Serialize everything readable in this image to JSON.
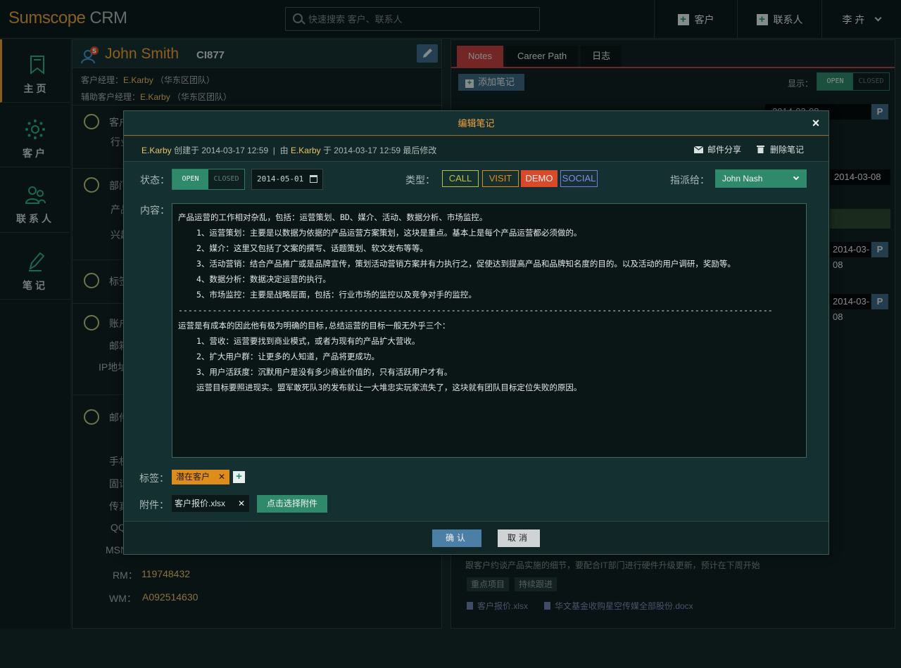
{
  "app": {
    "brand": "Sumscope",
    "product": "CRM"
  },
  "search": {
    "placeholder": "快速搜索 客户、联系人"
  },
  "header": {
    "add_customer": "客户",
    "add_contact": "联系人",
    "user": "李 卉"
  },
  "sidebar": {
    "items": [
      {
        "label": "主页",
        "icon": "bookmark-icon"
      },
      {
        "label": "客户",
        "icon": "gear-icon"
      },
      {
        "label": "联系人",
        "icon": "people-icon"
      },
      {
        "label": "笔记",
        "icon": "pen-icon"
      }
    ]
  },
  "profile": {
    "name": "John Smith",
    "code": "CI877",
    "account_manager_label": "客户经理：",
    "account_manager": "E.Karby",
    "account_manager_team": "（华东区团队）",
    "assistant_manager_label": "辅助客户经理：",
    "assistant_manager": "E.Karby",
    "assistant_manager_team": "（华东区团队）",
    "sections": {
      "customer": "客户",
      "industry": "行业",
      "department": "部门",
      "product": "产品",
      "interest": "兴趣",
      "tags": "标签",
      "account": "账户",
      "email": "邮箱",
      "ip": "IP地址",
      "mail": "邮件",
      "phone": "手机",
      "landline": "固话",
      "fax": "传真",
      "qq": "QQ",
      "msn": "MSN"
    },
    "rm_label": "RM：",
    "rm": "119748432",
    "wm_label": "WM：",
    "wm": "A092514630"
  },
  "notes_panel": {
    "tabs": [
      "Notes",
      "Career Path",
      "日志"
    ],
    "add_note": "添加笔记",
    "display_label": "显示：",
    "toggle_open": "OPEN",
    "toggle_closed": "CLOSED",
    "dates": [
      "2014-03-08",
      "2014-03-08",
      "2014-03-08",
      "2014-03-08"
    ],
    "badge": "P",
    "bg_desc": "跟客户约谈产品实施的细节，要配合IT部门进行硬件升级更新，预计在下周开始",
    "bg_tags": [
      "重点项目",
      "持续跟进"
    ],
    "bg_files": [
      "客户报价.xlsx",
      "华文基金收购星空传媒全部股份.docx"
    ]
  },
  "modal": {
    "title": "编辑笔记",
    "creator": "E.Karby",
    "created_text": "创建于 2014-03-17 12:59",
    "by_text": "由",
    "modifier": "E.Karby",
    "modified_text": "于 2014-03-17 12:59 最后修改",
    "share_mail": "邮件分享",
    "delete_note": "删除笔记",
    "status_label": "状态：",
    "status_open": "OPEN",
    "status_closed": "CLOSED",
    "date": "2014-05-01",
    "type_label": "类型：",
    "types": [
      {
        "label": "CALL",
        "color": "#b8c04a"
      },
      {
        "label": "VISIT",
        "color": "#e08c1a"
      },
      {
        "label": "DEMO",
        "color": "#d84a2a"
      },
      {
        "label": "SOCIAL",
        "color": "#7a7ad8"
      }
    ],
    "assign_label": "指派给：",
    "assignee": "John Nash",
    "content_label": "内容：",
    "content_lines": [
      "产品运营的工作相对杂乱，包括：运营策划、BD、媒介、活动、数据分析、市场监控。",
      "1、运营策划：主要是以数据为依据的产品运营方案策划，这块是重点。基本上是每个产品运营都必须做的。",
      "2、媒介：这里又包括了文案的撰写、话题策划、软文发布等等。",
      "3、活动营销：结合产品推广或是品牌宣传，策划活动营销方案并有力执行之，促使达到提高产品和品牌知名度的目的。以及活动的用户调研，奖励等。",
      "4、数据分析：数据决定运营的执行。",
      "5、市场监控：主要是战略层面，包括：行业市场的监控以及竞争对手的监控。",
      "--------------------------------------------------------------------------------------------------------------------------",
      "运营是有成本的因此他有极为明确的目标,总结运营的目标一般无外乎三个：",
      "1、营收：运营要找到商业模式，或者为现有的产品扩大营收。",
      "2、扩大用户群：让更多的人知道，产品将更成功。",
      "3、用户活跃度：沉默用户是没有多少商业价值的，只有活跃用户才有。",
      "运营目标要照进现实。盟军敢死队3的发布就让一大堆忠实玩家流失了，这块就有团队目标定位失败的原因。"
    ],
    "tags_label": "标签：",
    "tag": "潜在客户",
    "attach_label": "附件：",
    "attachment": "客户报价.xlsx",
    "choose_attachment": "点击选择附件",
    "confirm": "确认",
    "cancel": "取消"
  }
}
